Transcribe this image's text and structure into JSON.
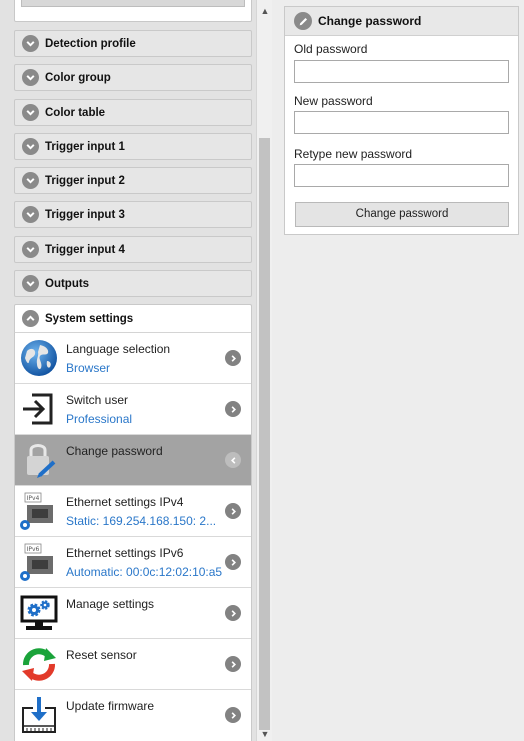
{
  "menu": {
    "sections": [
      {
        "label": "Detection profile",
        "icon": "chevron-down-icon"
      },
      {
        "label": "Color group",
        "icon": "chevron-down-icon"
      },
      {
        "label": "Color table",
        "icon": "chevron-down-icon"
      },
      {
        "label": "Trigger input 1",
        "icon": "chevron-down-icon"
      },
      {
        "label": "Trigger input 2",
        "icon": "chevron-down-icon"
      },
      {
        "label": "Trigger input 3",
        "icon": "chevron-down-icon"
      },
      {
        "label": "Trigger input 4",
        "icon": "chevron-down-icon"
      },
      {
        "label": "Outputs",
        "icon": "chevron-down-icon"
      },
      {
        "label": "System settings",
        "icon": "chevron-up-icon"
      }
    ]
  },
  "system_settings": {
    "items": [
      {
        "title": "Language selection",
        "value": "Browser",
        "icon": "globe-icon"
      },
      {
        "title": "Switch user",
        "value": "Professional",
        "icon": "login-arrow-icon"
      },
      {
        "title": "Change password",
        "value": "",
        "icon": "padlock-pen-icon",
        "active": true
      },
      {
        "title": "Ethernet settings IPv4",
        "value": "Static: 169.254.168.150: 2...",
        "icon": "ethernet-ipv4-icon",
        "badge": "IPv4"
      },
      {
        "title": "Ethernet settings IPv6",
        "value": "Automatic: 00:0c:12:02:10:a5",
        "icon": "ethernet-ipv6-icon",
        "badge": "IPv6"
      },
      {
        "title": "Manage settings",
        "value": "",
        "icon": "monitor-gears-icon"
      },
      {
        "title": "Reset sensor",
        "value": "",
        "icon": "refresh-arrows-icon"
      },
      {
        "title": "Update firmware",
        "value": "",
        "icon": "firmware-download-icon"
      }
    ]
  },
  "change_password": {
    "title": "Change password",
    "icon": "pencil-icon",
    "old_label": "Old password",
    "old_value": "",
    "new_label": "New password",
    "new_value": "",
    "retype_label": "Retype new password",
    "retype_value": "",
    "button_label": "Change password"
  },
  "colors": {
    "link": "#2a77c9",
    "active_row": "#a3a3a3",
    "panel_bg": "#ededed"
  }
}
